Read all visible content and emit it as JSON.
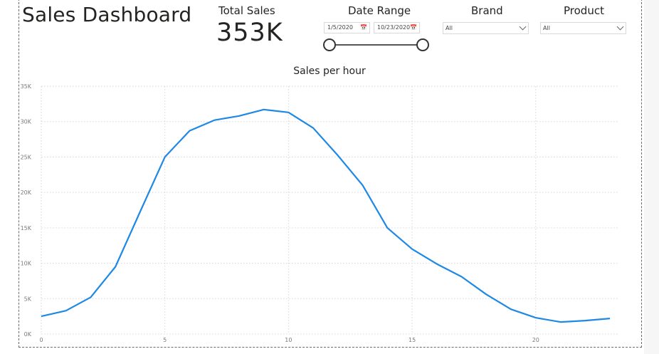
{
  "dashboard": {
    "title": "Sales Dashboard"
  },
  "kpi": {
    "label": "Total Sales",
    "value": "353K"
  },
  "date_range": {
    "title": "Date Range",
    "start": "1/5/2020",
    "end": "10/23/2020",
    "slider_start": 0,
    "slider_end": 1
  },
  "brand": {
    "title": "Brand",
    "selected": "All"
  },
  "product": {
    "title": "Product",
    "selected": "All"
  },
  "colors": {
    "line": "#1e88e5",
    "grid": "#d6d6d6",
    "axis_text": "#7a7a7a"
  },
  "chart_data": {
    "type": "line",
    "title": "Sales per hour",
    "xlabel": "",
    "ylabel": "",
    "x": [
      0,
      1,
      2,
      3,
      4,
      5,
      6,
      7,
      8,
      9,
      10,
      11,
      12,
      13,
      14,
      15,
      16,
      17,
      18,
      19,
      20,
      21,
      22,
      23
    ],
    "series": [
      {
        "values": [
          2500,
          3300,
          5200,
          9500,
          17300,
          25000,
          28700,
          30200,
          30800,
          31700,
          31300,
          29100,
          25200,
          21000,
          15000,
          12000,
          9900,
          8100,
          5600,
          3500,
          2300,
          1700,
          1900,
          2200
        ]
      }
    ],
    "xticks": [
      0,
      5,
      10,
      15,
      20
    ],
    "xtick_labels": [
      "0",
      "5",
      "10",
      "15",
      "20"
    ],
    "yticks": [
      0,
      5000,
      10000,
      15000,
      20000,
      25000,
      30000,
      35000
    ],
    "ytick_labels": [
      "0K",
      "5K",
      "10K",
      "15K",
      "20K",
      "25K",
      "30K",
      "35K"
    ],
    "ylim": [
      0,
      35000
    ],
    "xlim": [
      0,
      23
    ],
    "grid": true
  }
}
